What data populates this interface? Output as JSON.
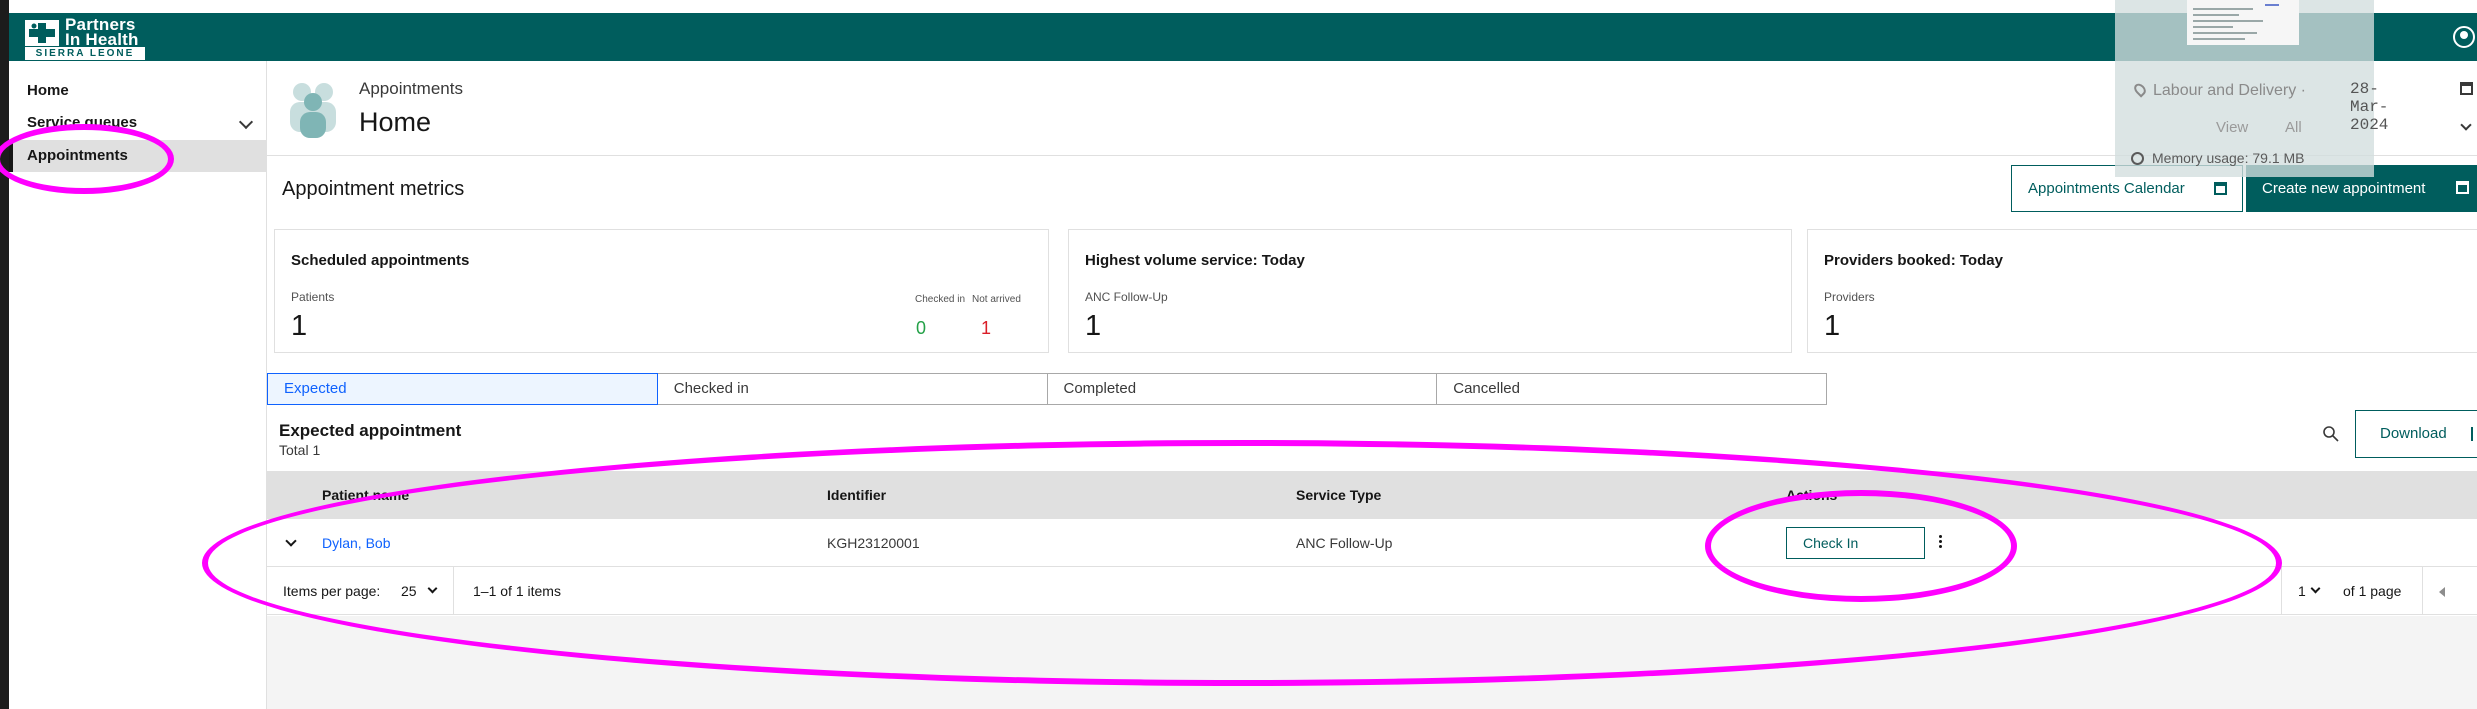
{
  "header": {
    "logo_line1": "Partners",
    "logo_line2": "In Health",
    "logo_sub": "SIERRA LEONE"
  },
  "sidebar": {
    "items": [
      {
        "label": "Home"
      },
      {
        "label": "Service queues"
      },
      {
        "label": "Appointments"
      }
    ]
  },
  "page": {
    "breadcrumb": "Appointments",
    "title": "Home"
  },
  "overlay": {
    "location": "Labour and Delivery",
    "separator": "·",
    "date": "28-Mar-2024",
    "view_label": "View",
    "view_value": "All",
    "memory": "Memory usage: 79.1 MB"
  },
  "metrics": {
    "title": "Appointment metrics",
    "calendar_button": "Appointments Calendar",
    "create_button": "Create new appointment",
    "tiles": [
      {
        "title": "Scheduled appointments",
        "sub": "Patients",
        "value": "1",
        "checked_in_label": "Checked in",
        "checked_in_value": "0",
        "not_arrived_label": "Not arrived",
        "not_arrived_value": "1"
      },
      {
        "title": "Highest volume service: Today",
        "sub": "ANC Follow-Up",
        "value": "1"
      },
      {
        "title": "Providers booked: Today",
        "sub": "Providers",
        "value": "1"
      }
    ],
    "colors": {
      "checked_in": "#24a148",
      "not_arrived": "#da1e28",
      "brand": "#005d5d"
    }
  },
  "tabs": [
    {
      "label": "Expected",
      "active": true
    },
    {
      "label": "Checked in",
      "active": false
    },
    {
      "label": "Completed",
      "active": false
    },
    {
      "label": "Cancelled",
      "active": false
    }
  ],
  "table": {
    "title": "Expected appointment",
    "total": "Total 1",
    "download": "Download",
    "columns": [
      "Patient name",
      "Identifier",
      "Service Type",
      "Actions"
    ],
    "rows": [
      {
        "patient": "Dylan, Bob",
        "identifier": "KGH23120001",
        "service": "ANC Follow-Up",
        "action": "Check In"
      }
    ]
  },
  "pagination": {
    "items_per_page_label": "Items per page:",
    "items_per_page": "25",
    "range": "1–1 of 1 items",
    "page": "1",
    "of_pages": "of 1 page"
  }
}
